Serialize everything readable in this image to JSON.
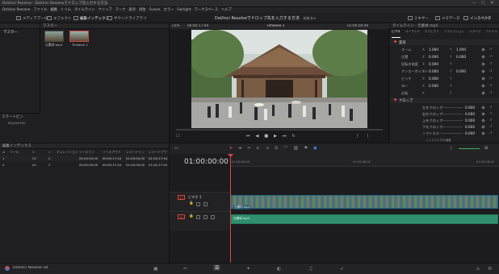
{
  "window": {
    "title": "DaVinci Resolve - DaVinci Resolveでドロップ先入力する方法",
    "project_title": "DaVinci Resolveでドロップ先を入力する方法",
    "edited": "編集済み"
  },
  "menu": [
    "DaVinci Resolve",
    "ファイル",
    "編集",
    "トリム",
    "タイムライン",
    "クリップ",
    "マーク",
    "表示",
    "再生",
    "Fusion",
    "カラー",
    "Fairlight",
    "ワークスペース",
    "ヘルプ"
  ],
  "toolbar": {
    "left": [
      "メディアプール",
      "エフェクト",
      "編集インデックス",
      "サウンドライブラリ"
    ],
    "right": [
      "ミキサー",
      "メタデータ",
      "インスペクタ"
    ]
  },
  "media_pool": {
    "header": "マスター",
    "zoom": "25%",
    "timecode": "00:00:17:44",
    "sidebar_label": "マスター",
    "clips": [
      {
        "label": "元素材.mp4"
      },
      {
        "label": "Timeline 1"
      }
    ],
    "smart_bins_label": "スマートビン",
    "keywords_label": "Keywords"
  },
  "viewer": {
    "timeline_name": "Timeline 1",
    "timecode_right": "01:00:00:00"
  },
  "inspector": {
    "title": "タイムライン - 元素材.mp4",
    "tabs": [
      "ビデオ",
      "オーディオ",
      "エフェクト",
      "トランジション",
      "イメージ",
      "ファイル"
    ],
    "transform_label": "変形",
    "transform_rows": [
      {
        "label": "ズーム",
        "x": "1.000",
        "y": "1.000"
      },
      {
        "label": "位置",
        "x": "0.000",
        "y": "0.000"
      },
      {
        "label": "回転の角度",
        "x": "0.000",
        "y": ""
      },
      {
        "label": "アンカーポイント",
        "x": "0.000",
        "y": "0.000"
      },
      {
        "label": "ピッチ",
        "x": "0.000",
        "y": ""
      },
      {
        "label": "ヨー",
        "x": "0.000",
        "y": ""
      },
      {
        "label": "反転",
        "x": "",
        "y": ""
      }
    ],
    "crop_label": "クロップ",
    "crop_rows": [
      {
        "label": "左をクロップ",
        "value": "0.000"
      },
      {
        "label": "右をクロップ",
        "value": "0.000"
      },
      {
        "label": "上をクロップ",
        "value": "0.000"
      },
      {
        "label": "下をクロップ",
        "value": "0.000"
      },
      {
        "label": "ソフトネス",
        "value": "0.000"
      }
    ],
    "footer": "インスペクタを編集"
  },
  "edit_index": {
    "title": "編集インデックス",
    "columns": [
      "#",
      "リール",
      "V",
      "C",
      "デュレーション",
      "ソースイン",
      "ソースアウト",
      "レコードイン",
      "レコードアウト"
    ],
    "rows": [
      [
        "1",
        "",
        "V1",
        "C",
        "",
        "00:00:00:00",
        "00:00:17:44",
        "01:00:00:00",
        "01:00:17:44"
      ],
      [
        "2",
        "",
        "A1",
        "C",
        "",
        "00:00:00:00",
        "00:00:17:44",
        "01:00:00:00",
        "01:00:17:44"
      ]
    ]
  },
  "timeline": {
    "timecode": "01:00:00:00",
    "ruler_labels": [
      "01:00:00:00",
      "01:00:08:00",
      "01:00:16:00"
    ],
    "video_track": {
      "id": "V1",
      "name": "ビデオ 1",
      "clip_label": "元素材.mp4"
    },
    "audio_track": {
      "id": "A1",
      "clip_label": "元素材.mp4"
    }
  },
  "footer": {
    "app_name": "DaVinci Resolve 18"
  },
  "colors": {
    "accent_red": "#e0443a",
    "track_audio": "#2f8f6f",
    "video_clip_border": "#2a6a8a"
  }
}
